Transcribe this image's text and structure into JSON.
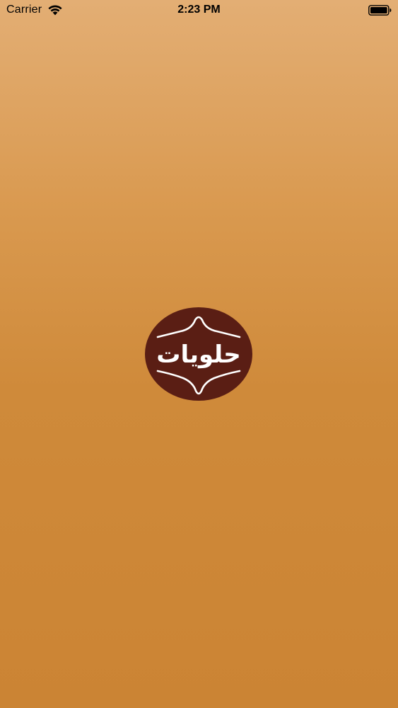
{
  "status_bar": {
    "carrier": "Carrier",
    "time": "2:23 PM",
    "wifi_icon": "wifi-icon",
    "battery_icon": "battery-icon"
  },
  "splash": {
    "logo_text": "حلويات",
    "logo_icon": "halawiyat-logo",
    "colors": {
      "background_top": "#E3AE74",
      "background_bottom": "#CB8434",
      "logo_fill": "#5A1E14",
      "logo_line": "#FFFFFF"
    }
  }
}
